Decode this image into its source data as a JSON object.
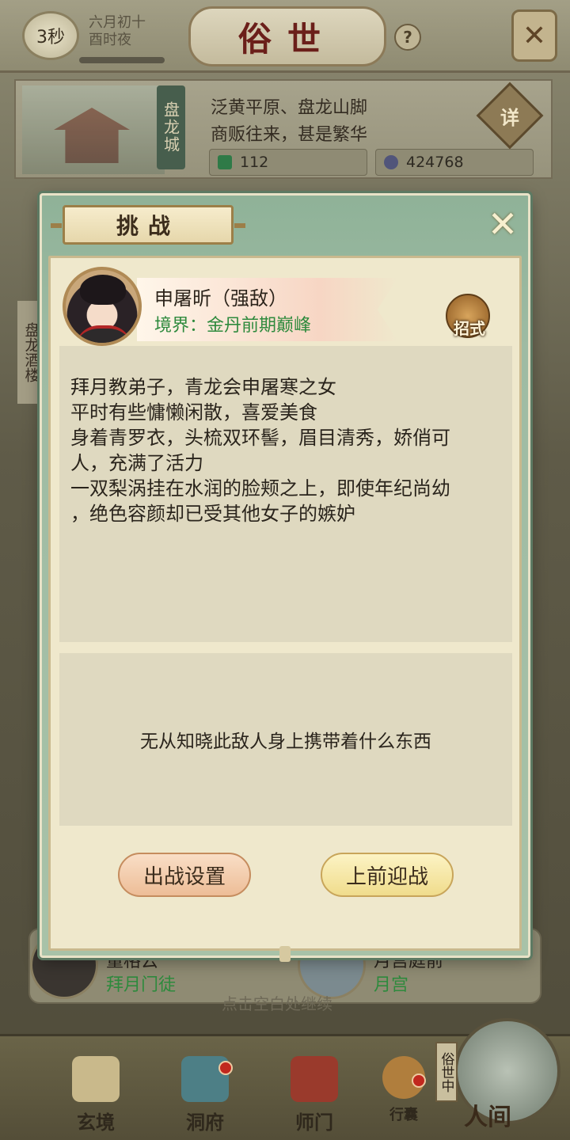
{
  "top_bar": {
    "timer": "3秒",
    "date_line1": "六月初十",
    "date_line2": "酉时夜",
    "title": "俗世",
    "help_label": "?"
  },
  "location": {
    "city": "盘龙城",
    "line1": "泛黄平原、盘龙山脚",
    "line2": "商贩往来，甚是繁华",
    "money": "112",
    "coins": "424768",
    "detail_label": "详"
  },
  "side_sign": "盘龙酒楼",
  "background_list": {
    "row1_name": "董格云",
    "row1_sect": "拜月门徒",
    "row2_name": "月宫庭前",
    "row2_sect": "月宫",
    "hint": "点击空白处继续"
  },
  "modal": {
    "title": "挑战",
    "enemy_name": "申屠昕（强敌）",
    "enemy_realm": "境界：金丹前期巅峰",
    "skill_label": "招式",
    "description": [
      "  拜月教弟子，青龙会申屠寒之女",
      "  平时有些慵懒闲散，喜爱美食",
      "  身着青罗衣，头梳双环髻，眉目清秀，娇俏可",
      "人，充满了活力",
      "  一双梨涡挂在水润的脸颊之上，即使年纪尚幼",
      "，绝色容颜却已受其他女子的嫉妒"
    ],
    "loot_text": "无从知晓此敌人身上携带着什么东西",
    "settings_button": "出战设置",
    "fight_button": "上前迎战"
  },
  "bottom_nav": {
    "items": [
      "玄境",
      "洞府",
      "师门",
      "行囊"
    ],
    "world_label": "人间",
    "world_tag": "俗世中"
  },
  "colors": {
    "modal_green": "#9ebba3",
    "paper": "#efe8cc",
    "realm_green": "#2e8a3d",
    "title_red": "#6b1f1a"
  }
}
